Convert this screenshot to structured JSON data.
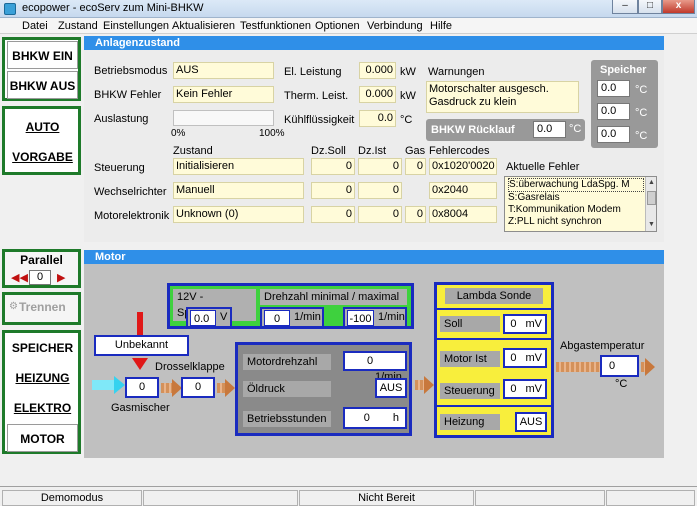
{
  "window": {
    "title": "ecopower - ecoServ zum Mini-BHKW",
    "min": "–",
    "max": "□",
    "close": "x"
  },
  "menu": [
    "Datei",
    "Zustand",
    "Einstellungen",
    "Aktualisieren",
    "Testfunktionen",
    "Optionen",
    "Verbindung",
    "Hilfe"
  ],
  "sidebar": {
    "bhkw_ein": "BHKW EIN",
    "bhkw_aus": "BHKW AUS",
    "auto": "AUTO",
    "vorgabe": "VORGABE",
    "parallel": "Parallel",
    "parallel_value": "0",
    "trennen": "Trennen",
    "speicher": "SPEICHER",
    "heizung": "HEIZUNG",
    "elektro": "ELEKTRO",
    "motor": "MOTOR"
  },
  "anlagen": {
    "title": "Anlagenzustand",
    "betriebsmodus_label": "Betriebsmodus",
    "betriebsmodus": "AUS",
    "fehler_label": "BHKW Fehler",
    "fehler": "Kein Fehler",
    "auslastung_label": "Auslastung",
    "scale_min": "0%",
    "scale_max": "100%",
    "auslastung_pct": 0,
    "el_label": "El. Leistung",
    "el_value": "0.000",
    "el_unit": "kW",
    "therm_label": "Therm. Leist.",
    "therm_value": "0.000",
    "therm_unit": "kW",
    "kuehl_label": "Kühlflüssigkeit",
    "kuehl_value": "0.0",
    "kuehl_unit": "°C",
    "warnungen_label": "Warnungen",
    "warnungen_text1": "Motorschalter ausgesch.",
    "warnungen_text2": "Gasdruck zu klein",
    "ruecklauf_label": "BHKW Rücklauf",
    "ruecklauf_value": "0.0",
    "ruecklauf_unit": "°C",
    "speicher_label": "Speicher",
    "speicher_values": [
      "0.0",
      "0.0",
      "0.0"
    ],
    "speicher_unit": "°C",
    "col_zustand": "Zustand",
    "col_dzsoll": "Dz.Soll",
    "col_dzist": "Dz.Ist",
    "col_gas": "Gas",
    "col_fehlercodes": "Fehlercodes",
    "rows": [
      {
        "label": "Steuerung",
        "zustand": "Initialisieren",
        "dzsoll": "0",
        "dzist": "0",
        "gas": "0",
        "code": "0x1020'0020"
      },
      {
        "label": "Wechselrichter",
        "zustand": "Manuell",
        "dzsoll": "0",
        "dzist": "0",
        "gas": "",
        "code": "0x2040"
      },
      {
        "label": "Motorelektronik",
        "zustand": "Unknown (0)",
        "dzsoll": "0",
        "dzist": "0",
        "gas": "0",
        "code": "0x8004"
      }
    ],
    "aktuelle_label": "Aktuelle Fehler",
    "aktuelle_items": [
      "S:überwachung LdaSpg. M",
      "S:Gasrelais",
      "T:Kommunikation Modem",
      "Z:PLL nicht synchron"
    ]
  },
  "motor": {
    "title": "Motor",
    "spannung_label": "12V - Spannung",
    "spannung_value": "0.0",
    "spannung_unit": "V",
    "drehzahl_label": "Drehzahl minimal / maximal",
    "dmin_value": "0",
    "dmin_unit": "1/min",
    "dmax_value": "-100",
    "dmax_unit": "1/min",
    "unbekannt": "Unbekannt",
    "gasmischer_value": "0",
    "gasmischer_label": "Gasmischer",
    "drossel_label": "Drosselklappe",
    "drossel_value": "0",
    "motordrehzahl_label": "Motordrehzahl",
    "motordrehzahl_value": "0",
    "motordrehzahl_unit": "1/min",
    "oeldruck_label": "Öldruck",
    "oeldruck_value": "AUS",
    "betriebsstunden_label": "Betriebsstunden",
    "betriebsstunden_value": "0",
    "betriebsstunden_unit": "h",
    "lambda_label": "Lambda Sonde",
    "soll_label": "Soll",
    "soll_value": "0",
    "soll_unit": "mV",
    "motorist_label": "Motor Ist",
    "motorist_value": "0",
    "motorist_unit": "mV",
    "steuerung_label": "Steuerung",
    "steuerung_value": "0",
    "steuerung_unit": "mV",
    "heizung_label": "Heizung",
    "heizung_value": "AUS",
    "abgas_label": "Abgastemperatur",
    "abgas_value": "0",
    "abgas_unit": "°C"
  },
  "status": {
    "demomodus": "Demomodus",
    "nicht_bereit": "Nicht Bereit"
  }
}
